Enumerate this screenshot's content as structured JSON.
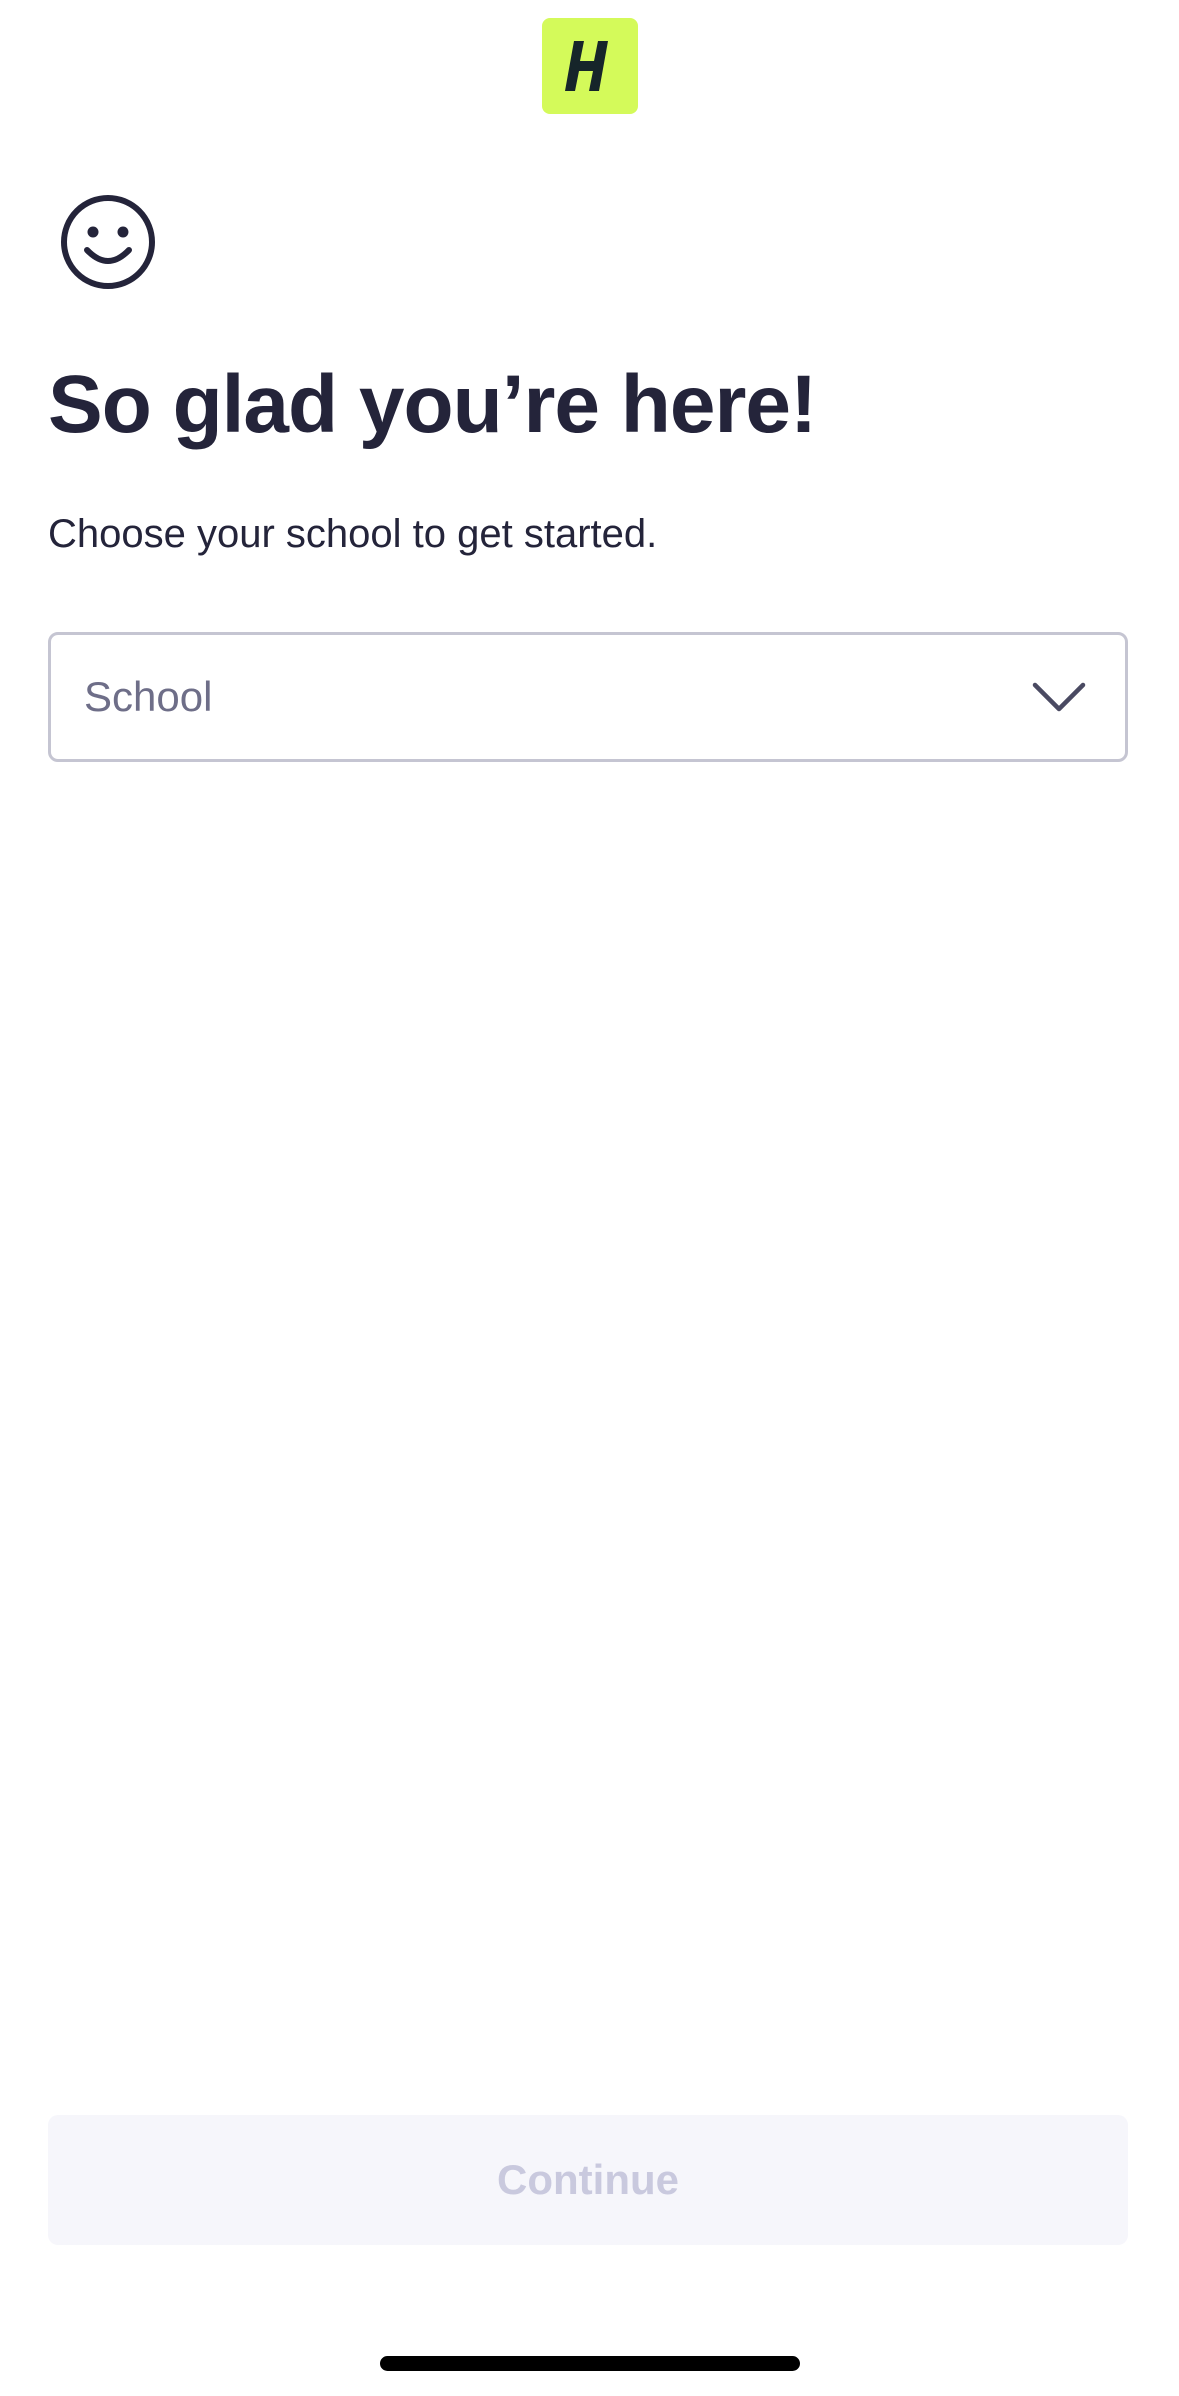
{
  "header": {
    "logo_icon": "h-brand-logo-icon",
    "logo_color": "#d4fa5a"
  },
  "welcome": {
    "icon": "smiley-icon",
    "title": "So glad you’re here!",
    "subtitle": "Choose your school to get started."
  },
  "school_select": {
    "placeholder": "School",
    "icon": "chevron-down-icon"
  },
  "footer": {
    "continue_label": "Continue"
  },
  "colors": {
    "text": "#24243a",
    "brand": "#d4fa5a",
    "button_disabled_bg": "#f6f6fb",
    "button_disabled_text": "#c9c9de"
  }
}
